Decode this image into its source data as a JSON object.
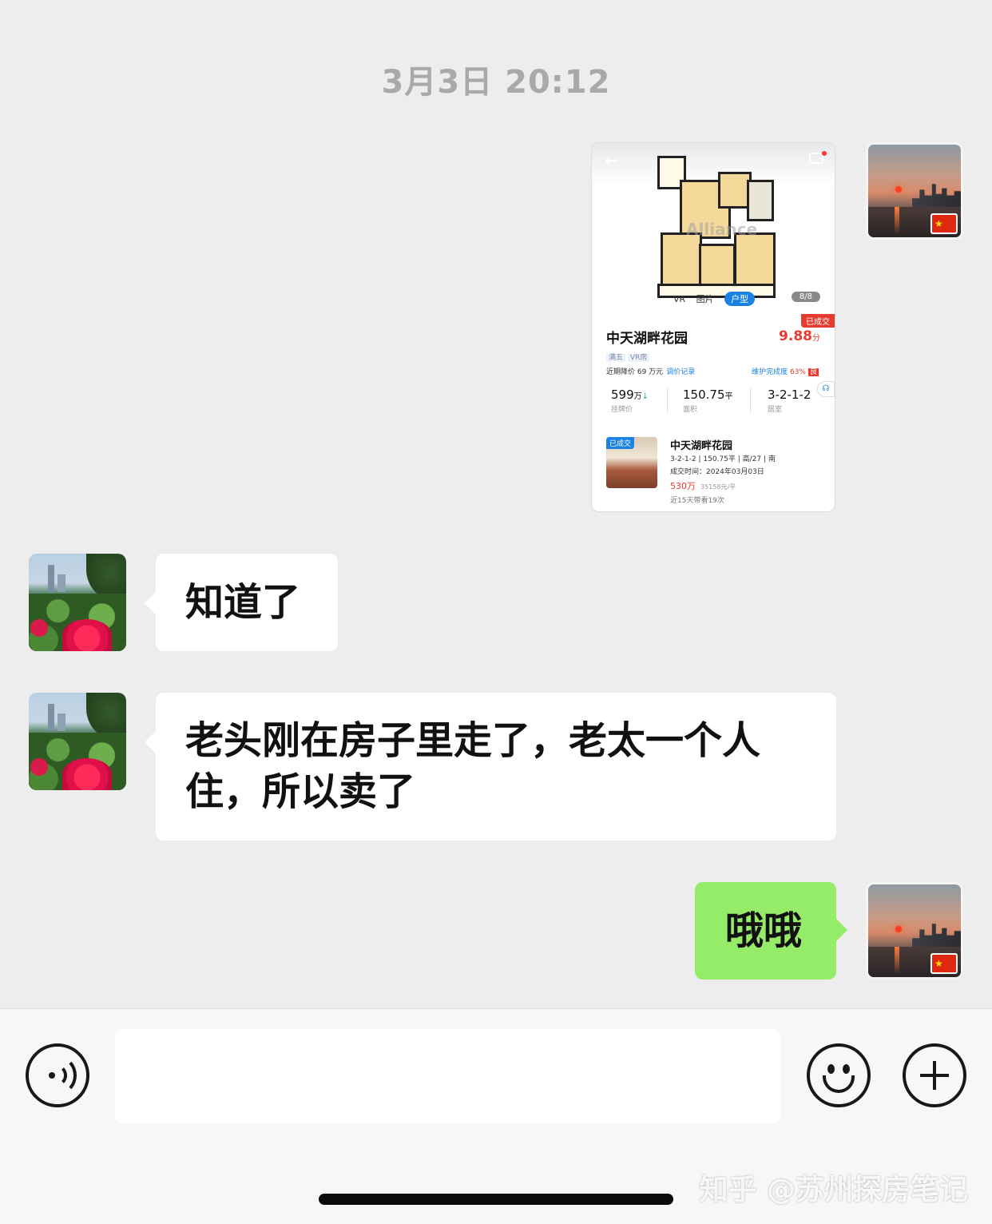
{
  "timestamp": "3月3日 20:12",
  "card": {
    "tabs": [
      "VR",
      "图片",
      "户型"
    ],
    "pager": "8/8",
    "watermark_text": "Alliance",
    "sold_tag": "已成交",
    "title": "中天湖畔花园",
    "score_value": "9.88",
    "score_unit": "分",
    "tags": [
      "满五",
      "VR房"
    ],
    "price_drop": "近期降价 69 万元",
    "price_history_link": "调价记录",
    "maintenance_label": "维护完成度",
    "maintenance_pct": "63%",
    "maintenance_grade": "良",
    "stats": [
      {
        "value": "599",
        "unit": "万",
        "label": "挂牌价"
      },
      {
        "value": "150.75",
        "unit": "平",
        "label": "面积"
      },
      {
        "value": "3-2-1-2",
        "unit": "",
        "label": "居室"
      }
    ],
    "deal": {
      "badge": "已成交",
      "title": "中天湖畔花园",
      "spec": "3-2-1-2 | 150.75平 | 高/27 | 南",
      "date": "成交时间：2024年03月03日",
      "price": "530万",
      "unit_price": "35158元/平",
      "visits": "近15天带看19次"
    }
  },
  "messages": [
    {
      "side": "left",
      "text": "知道了"
    },
    {
      "side": "left",
      "text": "老头刚在房子里走了，老太一个人住，所以卖了"
    },
    {
      "side": "right",
      "text": "哦哦"
    }
  ],
  "input": {
    "value": "",
    "placeholder": ""
  },
  "watermark": "知乎 @苏州探房笔记",
  "colors": {
    "background": "#ededed",
    "self_bubble": "#95ec69",
    "other_bubble": "#ffffff",
    "accent_red": "#e63b2e",
    "accent_blue": "#1a82e2"
  }
}
